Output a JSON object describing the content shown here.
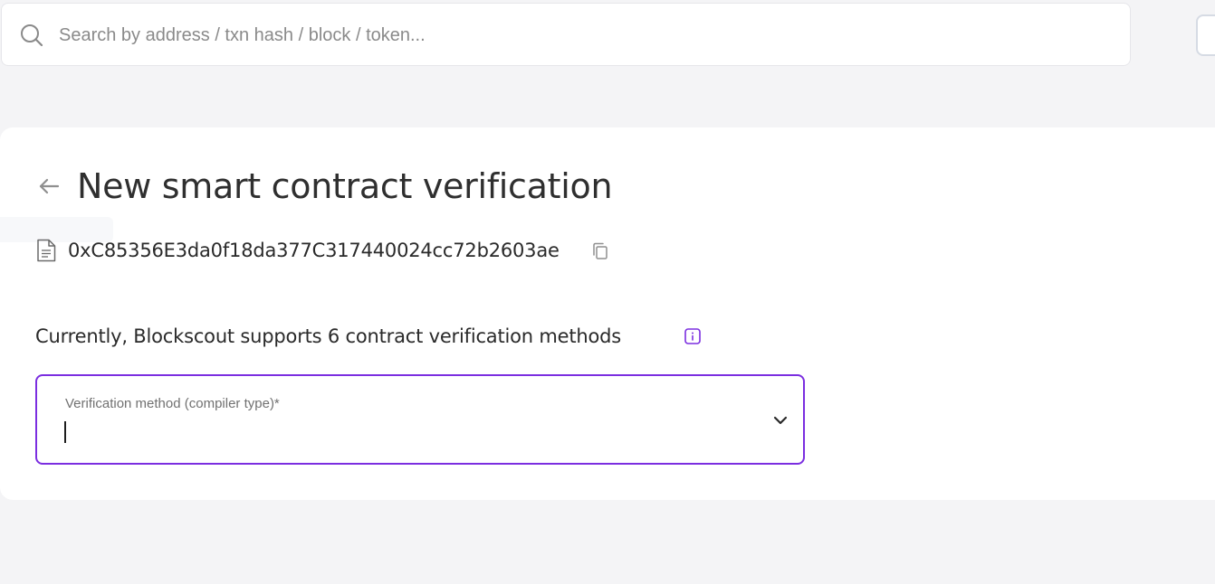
{
  "search": {
    "placeholder": "Search by address / txn hash / block / token...",
    "value": "",
    "icon": "search-icon"
  },
  "page": {
    "title": "New smart contract verification",
    "back_icon": "arrow-left-icon"
  },
  "contract": {
    "address": "0xC85356E3da0f18da377C317440024cc72b2603ae",
    "icon": "file-document-icon",
    "copy_icon": "copy-icon"
  },
  "methods": {
    "text": "Currently, Blockscout supports 6 contract verification methods",
    "info_icon": "info-icon"
  },
  "verification_method": {
    "label": "Verification method (compiler type)*",
    "value": "",
    "chevron_icon": "chevron-down-icon"
  },
  "colors": {
    "accent": "#7b2ee0",
    "background": "#f4f4f6",
    "card": "#ffffff",
    "text": "#2d2d2d",
    "muted": "#8a8a8a"
  }
}
